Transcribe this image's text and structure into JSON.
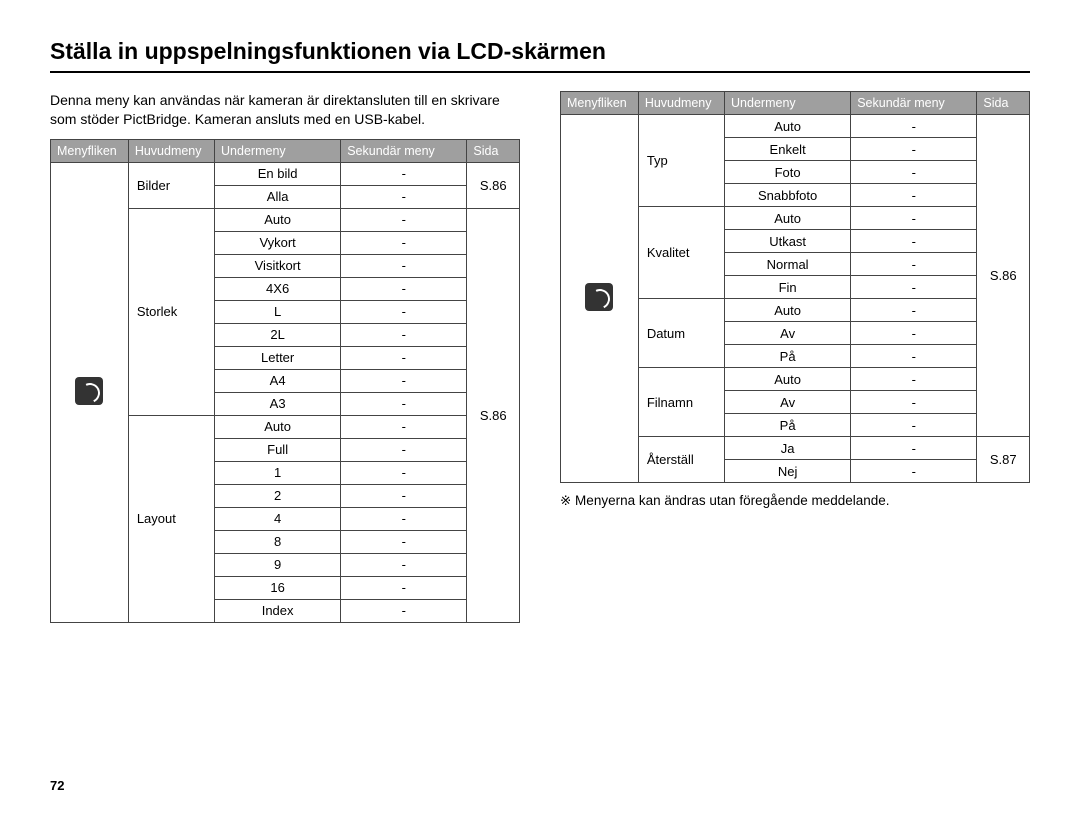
{
  "title": "Ställa in uppspelningsfunktionen via LCD-skärmen",
  "intro": "Denna meny kan användas när kameran är direktansluten till en skrivare som stöder PictBridge. Kameran ansluts med en USB-kabel.",
  "headers": {
    "tab": "Menyfliken",
    "main": "Huvudmeny",
    "sub": "Undermeny",
    "sec": "Sekundär meny",
    "page": "Sida"
  },
  "left": {
    "bilder": {
      "label": "Bilder",
      "rows": [
        {
          "sub": "En bild",
          "sec": "-"
        },
        {
          "sub": "Alla",
          "sec": "-"
        }
      ],
      "page": "S.86"
    },
    "storlek": {
      "label": "Storlek",
      "rows": [
        {
          "sub": "Auto",
          "sec": "-"
        },
        {
          "sub": "Vykort",
          "sec": "-"
        },
        {
          "sub": "Visitkort",
          "sec": "-"
        },
        {
          "sub": "4X6",
          "sec": "-"
        },
        {
          "sub": "L",
          "sec": "-"
        },
        {
          "sub": "2L",
          "sec": "-"
        },
        {
          "sub": "Letter",
          "sec": "-"
        },
        {
          "sub": "A4",
          "sec": "-"
        },
        {
          "sub": "A3",
          "sec": "-"
        }
      ]
    },
    "layout": {
      "label": "Layout",
      "rows": [
        {
          "sub": "Auto",
          "sec": "-"
        },
        {
          "sub": "Full",
          "sec": "-"
        },
        {
          "sub": "1",
          "sec": "-"
        },
        {
          "sub": "2",
          "sec": "-"
        },
        {
          "sub": "4",
          "sec": "-"
        },
        {
          "sub": "8",
          "sec": "-"
        },
        {
          "sub": "9",
          "sec": "-"
        },
        {
          "sub": "16",
          "sec": "-"
        },
        {
          "sub": "Index",
          "sec": "-"
        }
      ]
    },
    "page_sl": "S.86"
  },
  "right": {
    "typ": {
      "label": "Typ",
      "rows": [
        {
          "sub": "Auto",
          "sec": "-"
        },
        {
          "sub": "Enkelt",
          "sec": "-"
        },
        {
          "sub": "Foto",
          "sec": "-"
        },
        {
          "sub": "Snabbfoto",
          "sec": "-"
        }
      ]
    },
    "kvalitet": {
      "label": "Kvalitet",
      "rows": [
        {
          "sub": "Auto",
          "sec": "-"
        },
        {
          "sub": "Utkast",
          "sec": "-"
        },
        {
          "sub": "Normal",
          "sec": "-"
        },
        {
          "sub": "Fin",
          "sec": "-"
        }
      ]
    },
    "datum": {
      "label": "Datum",
      "rows": [
        {
          "sub": "Auto",
          "sec": "-"
        },
        {
          "sub": "Av",
          "sec": "-"
        },
        {
          "sub": "På",
          "sec": "-"
        }
      ]
    },
    "filnamn": {
      "label": "Filnamn",
      "rows": [
        {
          "sub": "Auto",
          "sec": "-"
        },
        {
          "sub": "Av",
          "sec": "-"
        },
        {
          "sub": "På",
          "sec": "-"
        }
      ]
    },
    "aterstall": {
      "label": "Återställ",
      "rows": [
        {
          "sub": "Ja",
          "sec": "-"
        },
        {
          "sub": "Nej",
          "sec": "-"
        }
      ],
      "page": "S.87"
    },
    "page_top": "S.86"
  },
  "note": "※ Menyerna kan ändras utan föregående meddelande.",
  "pagenum": "72"
}
